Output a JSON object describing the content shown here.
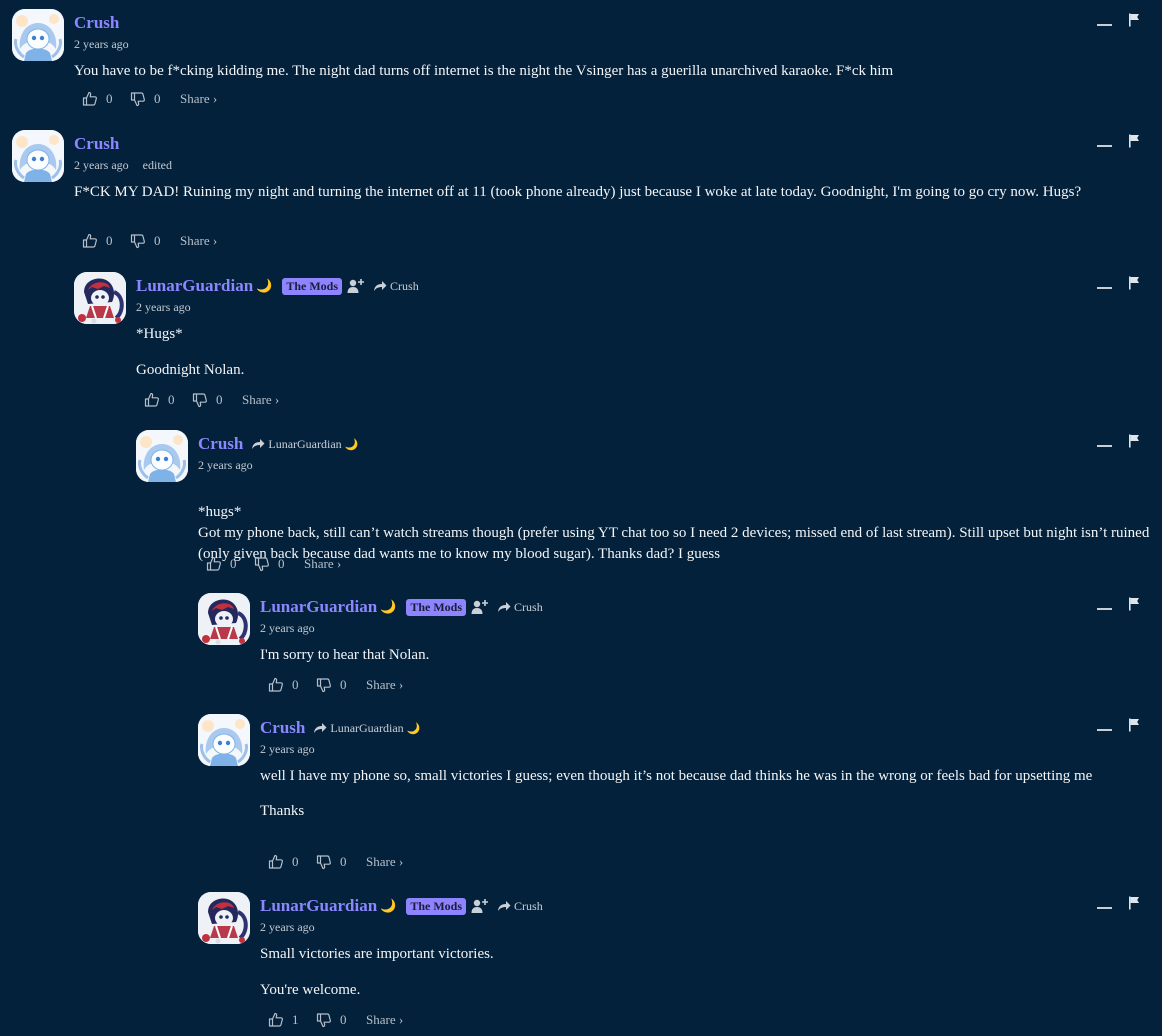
{
  "avatars": {
    "crush": {
      "bg": "#f4f7fb",
      "accent": "#7fb3e8",
      "hair": "#a9c9ef"
    },
    "lunar": {
      "bg": "#eef1f6",
      "accent": "#24285c",
      "hair": "#c2303e"
    }
  },
  "comments": [
    {
      "author": "Crush",
      "time": "2 years ago",
      "edited": "",
      "paragraphs": [
        "You have to be f*cking kidding me. The night dad turns off internet is the night the Vsinger has a guerilla unarchived karaoke. F*ck him"
      ],
      "likes": "0",
      "dislikes": "0",
      "share": "Share ›"
    },
    {
      "author": "Crush",
      "time": "2 years ago",
      "edited": "edited",
      "paragraphs": [
        "F*CK MY DAD! Ruining my night and turning the internet off at 11 (took phone already) just because I woke at late today. Goodnight, I'm going to go cry now. Hugs?"
      ],
      "likes": "0",
      "dislikes": "0",
      "share": "Share ›"
    },
    {
      "author": "LunarGuardian",
      "moon": "🌙",
      "badge": "The Mods",
      "reply_to": "Crush",
      "time": "2 years ago",
      "paragraphs": [
        "*Hugs*",
        "Goodnight Nolan."
      ],
      "likes": "0",
      "dislikes": "0",
      "share": "Share ›"
    },
    {
      "author": "Crush",
      "reply_to": "LunarGuardian",
      "reply_moon": "🌙",
      "time": "2 years ago",
      "paragraphs": [
        "*hugs*\nGot my phone back, still can’t watch streams though (prefer using YT chat too so I need 2 devices; missed end of last stream). Still upset but night isn’t ruined (only given back because dad wants me to know my blood sugar). Thanks dad? I guess"
      ],
      "likes": "0",
      "dislikes": "0",
      "share": "Share ›"
    },
    {
      "author": "LunarGuardian",
      "moon": "🌙",
      "badge": "The Mods",
      "reply_to": "Crush",
      "time": "2 years ago",
      "paragraphs": [
        "I'm sorry to hear that Nolan."
      ],
      "likes": "0",
      "dislikes": "0",
      "share": "Share ›"
    },
    {
      "author": "Crush",
      "reply_to": "LunarGuardian",
      "reply_moon": "🌙",
      "time": "2 years ago",
      "paragraphs": [
        "well I have my phone so, small victories I guess; even though it’s not because dad thinks he was in the wrong or feels bad for upsetting me",
        "Thanks"
      ],
      "likes": "0",
      "dislikes": "0",
      "share": "Share ›"
    },
    {
      "author": "LunarGuardian",
      "moon": "🌙",
      "badge": "The Mods",
      "reply_to": "Crush",
      "time": "2 years ago",
      "paragraphs": [
        "Small victories are important victories.",
        "You're welcome."
      ],
      "likes": "1",
      "dislikes": "0",
      "share": "Share ›"
    }
  ]
}
